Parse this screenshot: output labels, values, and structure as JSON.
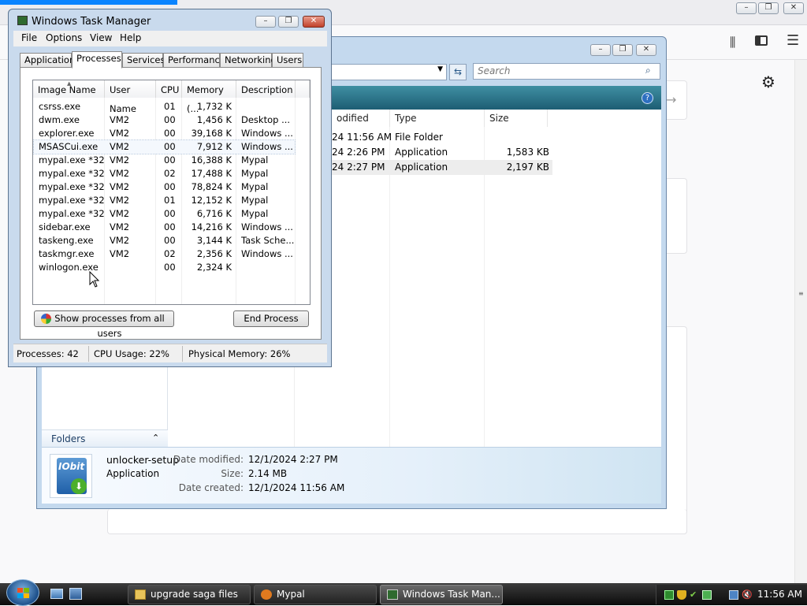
{
  "task_manager": {
    "title": "Windows Task Manager",
    "menu": [
      "File",
      "Options",
      "View",
      "Help"
    ],
    "tabs": [
      "Applications",
      "Processes",
      "Services",
      "Performance",
      "Networking",
      "Users"
    ],
    "active_tab": "Processes",
    "columns": [
      "Image Name",
      "User Name",
      "CPU",
      "Memory (...",
      "Description"
    ],
    "processes": [
      {
        "name": "csrss.exe",
        "user": "",
        "cpu": "01",
        "mem": "1,732 K",
        "desc": ""
      },
      {
        "name": "dwm.exe",
        "user": "VM2",
        "cpu": "00",
        "mem": "1,456 K",
        "desc": "Desktop ..."
      },
      {
        "name": "explorer.exe",
        "user": "VM2",
        "cpu": "00",
        "mem": "39,168 K",
        "desc": "Windows ..."
      },
      {
        "name": "MSASCui.exe",
        "user": "VM2",
        "cpu": "00",
        "mem": "7,912 K",
        "desc": "Windows ..."
      },
      {
        "name": "mypal.exe *32",
        "user": "VM2",
        "cpu": "00",
        "mem": "16,388 K",
        "desc": "Mypal"
      },
      {
        "name": "mypal.exe *32",
        "user": "VM2",
        "cpu": "02",
        "mem": "17,488 K",
        "desc": "Mypal"
      },
      {
        "name": "mypal.exe *32",
        "user": "VM2",
        "cpu": "00",
        "mem": "78,824 K",
        "desc": "Mypal"
      },
      {
        "name": "mypal.exe *32",
        "user": "VM2",
        "cpu": "01",
        "mem": "12,152 K",
        "desc": "Mypal"
      },
      {
        "name": "mypal.exe *32",
        "user": "VM2",
        "cpu": "00",
        "mem": "6,716 K",
        "desc": "Mypal"
      },
      {
        "name": "sidebar.exe",
        "user": "VM2",
        "cpu": "00",
        "mem": "14,216 K",
        "desc": "Windows ..."
      },
      {
        "name": "taskeng.exe",
        "user": "VM2",
        "cpu": "00",
        "mem": "3,144 K",
        "desc": "Task Sche..."
      },
      {
        "name": "taskmgr.exe",
        "user": "VM2",
        "cpu": "02",
        "mem": "2,356 K",
        "desc": "Windows ..."
      },
      {
        "name": "winlogon.exe",
        "user": "",
        "cpu": "00",
        "mem": "2,324 K",
        "desc": ""
      }
    ],
    "show_all_label": "Show processes from all users",
    "end_process_label": "End Process",
    "status": {
      "processes": "Processes: 42",
      "cpu": "CPU Usage: 22%",
      "memory": "Physical Memory: 26%"
    }
  },
  "explorer": {
    "search_placeholder": "Search",
    "columns": [
      "odified",
      "Type",
      "Size"
    ],
    "files": [
      {
        "modified": "24 11:56 AM",
        "type": "File Folder",
        "size": ""
      },
      {
        "modified": "24 2:26 PM",
        "type": "Application",
        "size": "1,583 KB"
      },
      {
        "modified": "24 2:27 PM",
        "type": "Application",
        "size": "2,197 KB"
      }
    ],
    "folders_label": "Folders",
    "details": {
      "name": "unlocker-setup",
      "type": "Application",
      "modified_label": "Date modified:",
      "modified_value": "12/1/2024 2:27 PM",
      "size_label": "Size:",
      "size_value": "2.14 MB",
      "created_label": "Date created:",
      "created_value": "12/1/2024 11:56 AM",
      "icon_text": "IObit"
    }
  },
  "taskbar": {
    "buttons": [
      "upgrade saga files",
      "Mypal",
      "Windows Task Man..."
    ],
    "clock": "11:56 AM"
  }
}
